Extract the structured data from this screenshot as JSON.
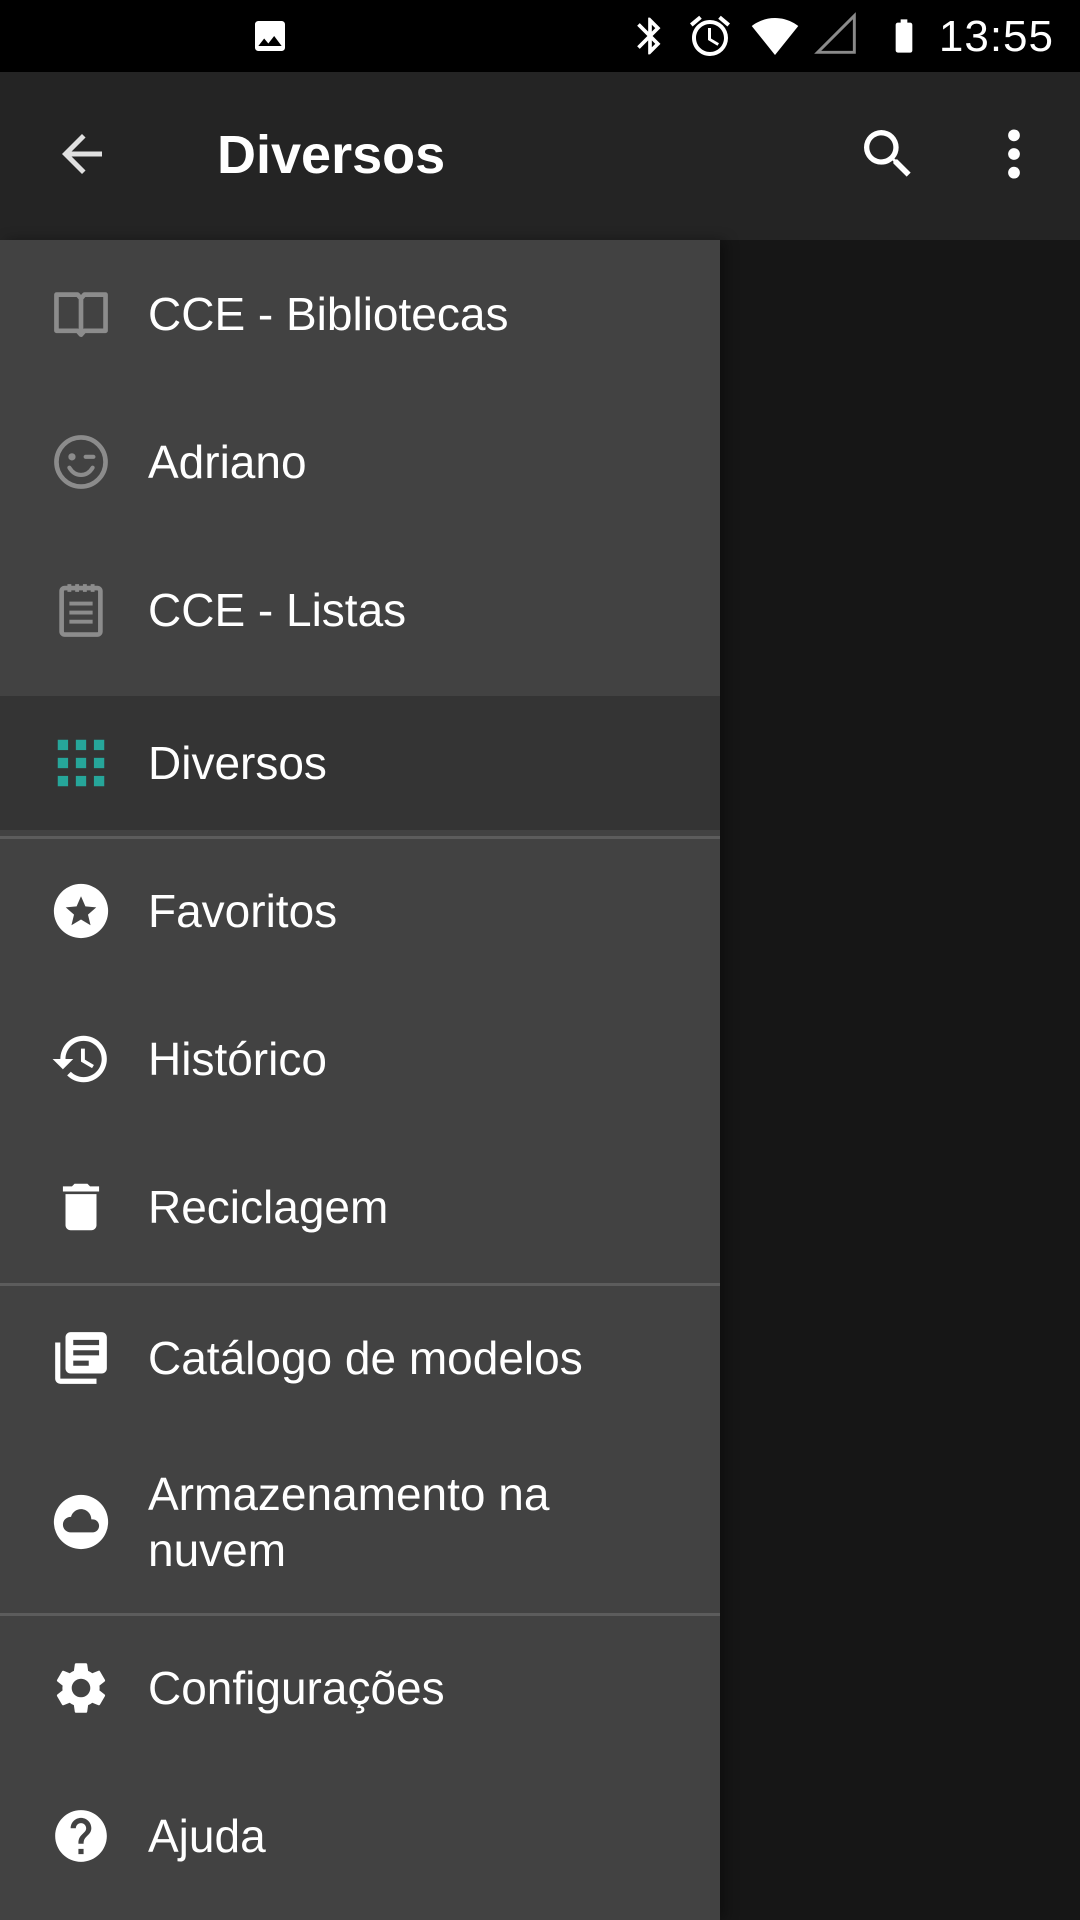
{
  "status_bar": {
    "time": "13:55",
    "icons": [
      "image-icon",
      "bluetooth-icon",
      "alarm-icon",
      "wifi-icon",
      "signal-icon",
      "battery-icon"
    ]
  },
  "app_bar": {
    "title": "Diversos",
    "icons": [
      "back-arrow-icon",
      "search-icon",
      "more-vert-icon"
    ]
  },
  "drawer": {
    "items": [
      {
        "label": "CCE - Bibliotecas",
        "icon": "book-open-icon"
      },
      {
        "label": "Adriano",
        "icon": "smiley-wink-icon"
      },
      {
        "label": "CCE - Listas",
        "icon": "notepad-icon"
      },
      {
        "label": "Diversos",
        "icon": "grid-apps-icon",
        "selected": true
      },
      {
        "label": "Favoritos",
        "icon": "star-circle-icon"
      },
      {
        "label": "Histórico",
        "icon": "history-icon"
      },
      {
        "label": "Reciclagem",
        "icon": "trash-icon"
      },
      {
        "label": "Catálogo de modelos",
        "icon": "library-books-icon"
      },
      {
        "label": "Armazenamento na nuvem",
        "icon": "cloud-circle-icon"
      },
      {
        "label": "Configurações",
        "icon": "gear-icon"
      },
      {
        "label": "Ajuda",
        "icon": "help-circle-icon"
      }
    ]
  },
  "colors": {
    "accent": "#26a69a",
    "drawer_bg": "#424242",
    "selected_bg": "#343434",
    "app_bar_bg": "#242424",
    "status_bar_bg": "#000000"
  }
}
